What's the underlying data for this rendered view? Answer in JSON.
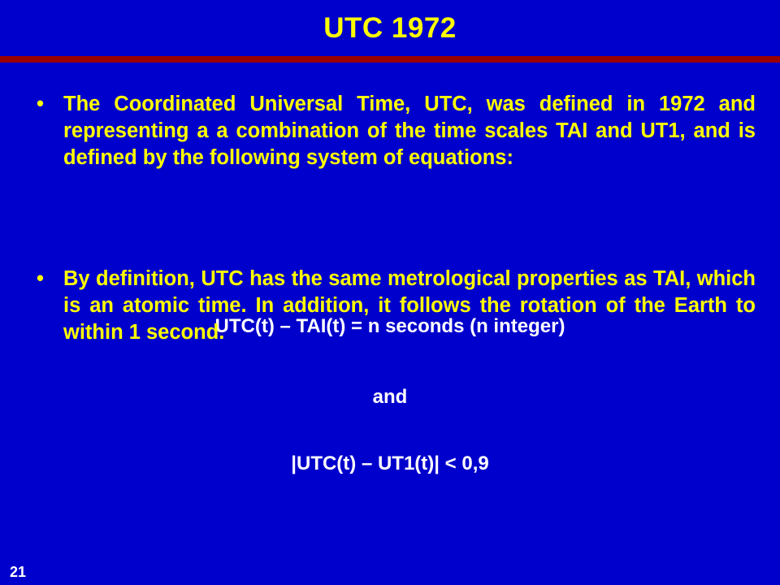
{
  "slide": {
    "title": "UTC 1972",
    "background_color": "#0000CC",
    "title_color": "#FFFF00",
    "body_color": "#FFFF00",
    "equation_color": "#FFFFFF",
    "rule_color": "#990000",
    "page_number": "21"
  },
  "body": {
    "bullet_marker": "•",
    "paragraphs": [
      {
        "id": "para-one",
        "text": "The Coordinated Universal Time, UTC, was defined in 1972 and representing a a combination of the time scales TAI and UT1, and is defined by the following system of equations:"
      },
      {
        "id": "para-two",
        "text": "By definition, UTC has the same metrological properties as TAI, which is an atomic time.  In addition, it follows the rotation of the Earth to within 1 second."
      }
    ],
    "equations": [
      {
        "id": "eq-1",
        "text": "UTC(t) – TAI(t) = n seconds (n integer)"
      },
      {
        "id": "eq-2",
        "text": "and"
      },
      {
        "id": "eq-3",
        "text": "|UTC(t) – UT1(t)| < 0,9"
      }
    ]
  }
}
